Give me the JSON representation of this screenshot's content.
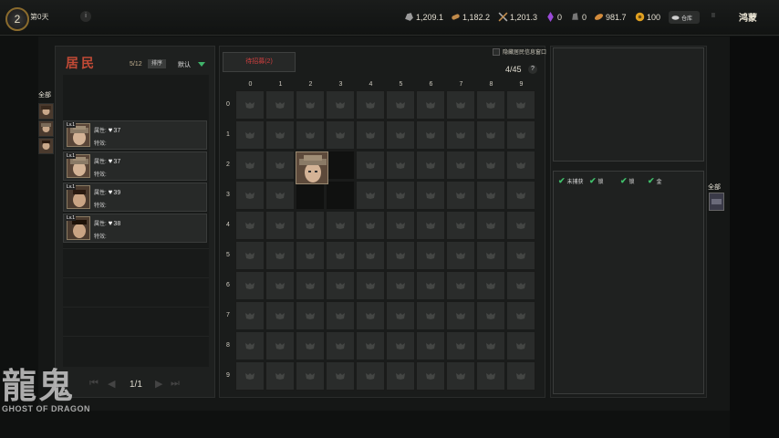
{
  "topbar": {
    "day_number": "2",
    "day_label": "第0天",
    "info_label": "i",
    "resources": [
      {
        "icon": "stone-icon",
        "value": "1,209.1"
      },
      {
        "icon": "wood-icon",
        "value": "1,182.2"
      },
      {
        "icon": "tools-icon",
        "value": "1,201.3"
      },
      {
        "icon": "purple-crystal-icon",
        "value": "0"
      },
      {
        "icon": "ore-icon",
        "value": "0"
      },
      {
        "icon": "bread-icon",
        "value": "981.7"
      },
      {
        "icon": "coin-icon",
        "value": "100"
      }
    ],
    "warehouse_label": "仓库",
    "pause_label": "II",
    "right_logo": "鸿蒙"
  },
  "left_panel": {
    "title": "居民",
    "count": "5/12",
    "sort_label": "排序",
    "default_label": "默认",
    "all_tab": "全部",
    "cards": [
      {
        "level": "Lv.1",
        "attr_label": "属性:",
        "hp": "37",
        "effect_label": "特效:"
      },
      {
        "level": "Lv.1",
        "attr_label": "属性:",
        "hp": "37",
        "effect_label": "特效:"
      },
      {
        "level": "Lv.1",
        "attr_label": "属性:",
        "hp": "39",
        "effect_label": "特效:"
      },
      {
        "level": "Lv.1",
        "attr_label": "属性:",
        "hp": "38",
        "effect_label": "特效:"
      }
    ],
    "pager": "1/1"
  },
  "center_panel": {
    "recruit_label": "待招募(2)",
    "hide_tip": "隐藏居民信息窗口",
    "grid_count": "4/45",
    "help_label": "?",
    "columns": [
      "0",
      "1",
      "2",
      "3",
      "4",
      "5",
      "6",
      "7",
      "8",
      "9"
    ],
    "rows": [
      "0",
      "1",
      "2",
      "3",
      "4",
      "5",
      "6",
      "7",
      "8",
      "9"
    ]
  },
  "right_panel": {
    "filters": [
      "未捕获",
      "锁",
      "锁",
      "金"
    ],
    "all_tab": "全部"
  },
  "watermark": {
    "chinese": "龍鬼",
    "english": "GHOST OF DRAGON"
  },
  "colors": {
    "accent_red": "#c24a36",
    "check_green": "#3fbf6a",
    "recruit_text": "#d13f3f"
  }
}
